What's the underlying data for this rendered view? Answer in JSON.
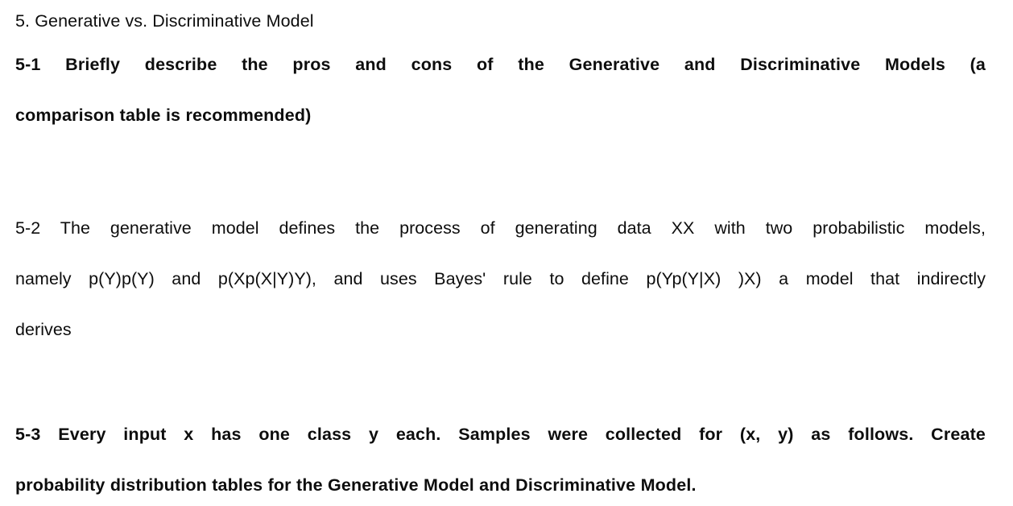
{
  "document": {
    "background_color": "#ffffff",
    "text_color": "#0d0d0d",
    "section_heading": "5. Generative vs. Discriminative Model",
    "items": [
      {
        "id": "5-1",
        "weight": "bold",
        "lines": [
          "5-1  Briefly  describe  the  pros  and  cons  of  the  Generative  and  Discriminative  Models  (a",
          "comparison table is recommended)"
        ],
        "full_text": "5-1 Briefly describe the pros and cons of the Generative and Discriminative Models (a comparison table is recommended)"
      },
      {
        "id": "5-2",
        "weight": "regular",
        "lines": [
          "5-2 The generative model defines the process of generating data XX with two probabilistic models,",
          "namely p(Y)p(Y) and p(Xp(X|Y)Y), and uses Bayes' rule to define p(Yp(Y|X) )X) a model that indirectly",
          "derives"
        ],
        "full_text": "5-2 The generative model defines the process of generating data XX with two probabilistic models, namely p(Y)p(Y) and p(Xp(X|Y)Y), and uses Bayes' rule to define p(Yp(Y|X) )X) a model that indirectly derives"
      },
      {
        "id": "5-3",
        "weight": "bold",
        "lines": [
          "5-3  Every  input  x  has  one  class  y  each.  Samples  were  collected  for  (x,  y)  as  follows.  Create",
          "probability distribution tables for the Generative Model and Discriminative Model."
        ],
        "full_text": "5-3 Every input x has one class y each. Samples were collected for (x, y) as follows. Create probability distribution tables for the Generative Model and Discriminative Model."
      }
    ]
  }
}
